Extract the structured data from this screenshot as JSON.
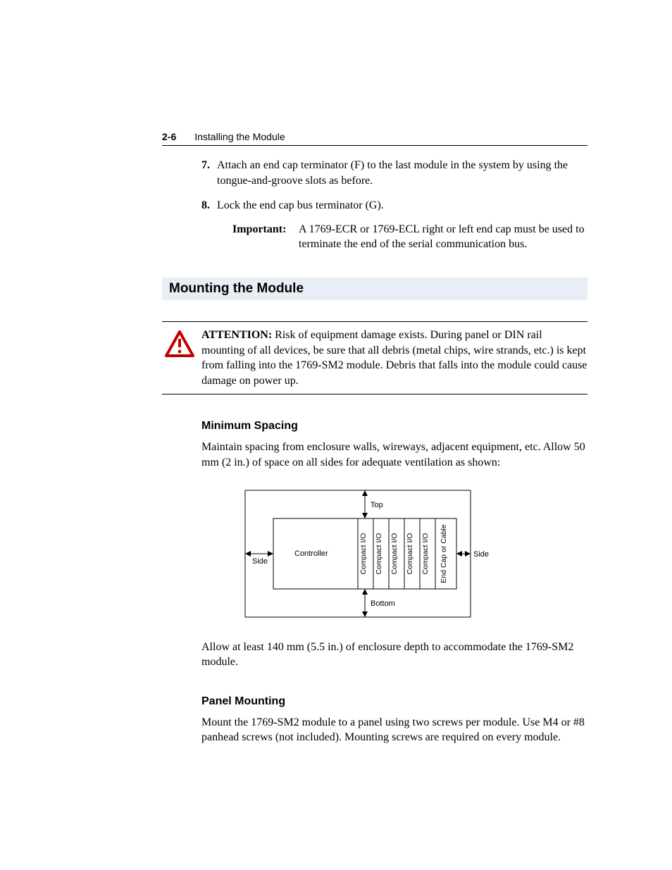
{
  "header": {
    "pagenum": "2-6",
    "chapter": "Installing the Module"
  },
  "steps": {
    "s7": {
      "num": "7.",
      "text": "Attach an end cap terminator (F) to the last module in the system by using the tongue-and-groove slots as before."
    },
    "s8": {
      "num": "8.",
      "text": "Lock the end cap bus terminator (G)."
    }
  },
  "important": {
    "label": "Important:",
    "text": "A 1769-ECR or 1769-ECL right or left end cap must be used to terminate the end of the serial communication bus."
  },
  "section_title": "Mounting the Module",
  "attention": {
    "label": "ATTENTION:",
    "text": "  Risk of equipment damage exists. During panel or DIN rail mounting of all devices, be sure that all debris (metal chips, wire strands, etc.) is kept from falling into the 1769-SM2 module. Debris that falls into the module could cause damage on power up."
  },
  "minspacing": {
    "title": "Minimum Spacing",
    "para1": "Maintain spacing from enclosure walls, wireways, adjacent equipment, etc. Allow 50 mm (2 in.) of space on all sides for adequate ventilation as shown:",
    "para2": "Allow at least 140 mm (5.5 in.) of enclosure depth to accommodate the 1769-SM2 module."
  },
  "diagram": {
    "top": "Top",
    "bottom": "Bottom",
    "side_left": "Side",
    "side_right": "Side",
    "controller": "Controller",
    "io": "Compact I/O",
    "endcap": "End Cap or Cable"
  },
  "panel": {
    "title": "Panel Mounting",
    "para": "Mount the 1769-SM2 module to a panel using two screws per module. Use M4 or #8 panhead screws (not included). Mounting screws are required on every module."
  }
}
